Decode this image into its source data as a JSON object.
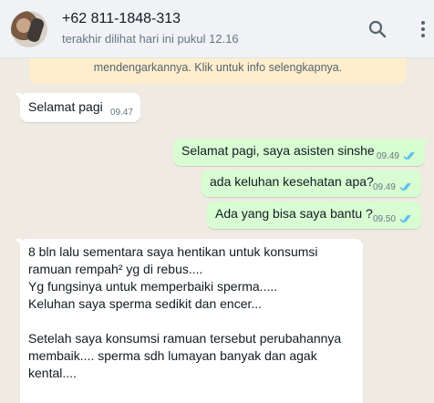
{
  "header": {
    "title": "+62 811-1848-313",
    "status": "terakhir dilihat hari ini pukul 12.16",
    "icons": [
      "search-icon",
      "more-vertical-icon"
    ]
  },
  "info_banner": {
    "text": "mendengarkannya. Klik untuk info selengkapnya."
  },
  "messages": [
    {
      "direction": "incoming",
      "text": "Selamat pagi",
      "time": "09.47"
    },
    {
      "direction": "outgoing",
      "text": "Selamat pagi, saya asisten sinshe",
      "time": "09.49",
      "read": true
    },
    {
      "direction": "outgoing",
      "text": "ada keluhan kesehatan apa?",
      "time": "09.49",
      "read": true
    },
    {
      "direction": "outgoing",
      "text": "Ada yang bisa saya bantu ?",
      "time": "09.50",
      "read": true
    },
    {
      "direction": "incoming",
      "text": "8 bln lalu sementara saya hentikan untuk konsumsi ramuan rempah² yg di rebus....\nYg fungsinya untuk memperbaiki sperma.....\nKeluhan saya sperma sedikit dan encer...\n\nSetelah saya konsumsi ramuan tersebut perubahannya membaik.... sperma sdh lumayan banyak dan agak kental....",
      "time": ""
    }
  ],
  "colors": {
    "incoming_bubble": "#ffffff",
    "outgoing_bubble": "#d9fdd3",
    "read_ticks": "#53bdeb",
    "chat_background": "#efeae2"
  }
}
